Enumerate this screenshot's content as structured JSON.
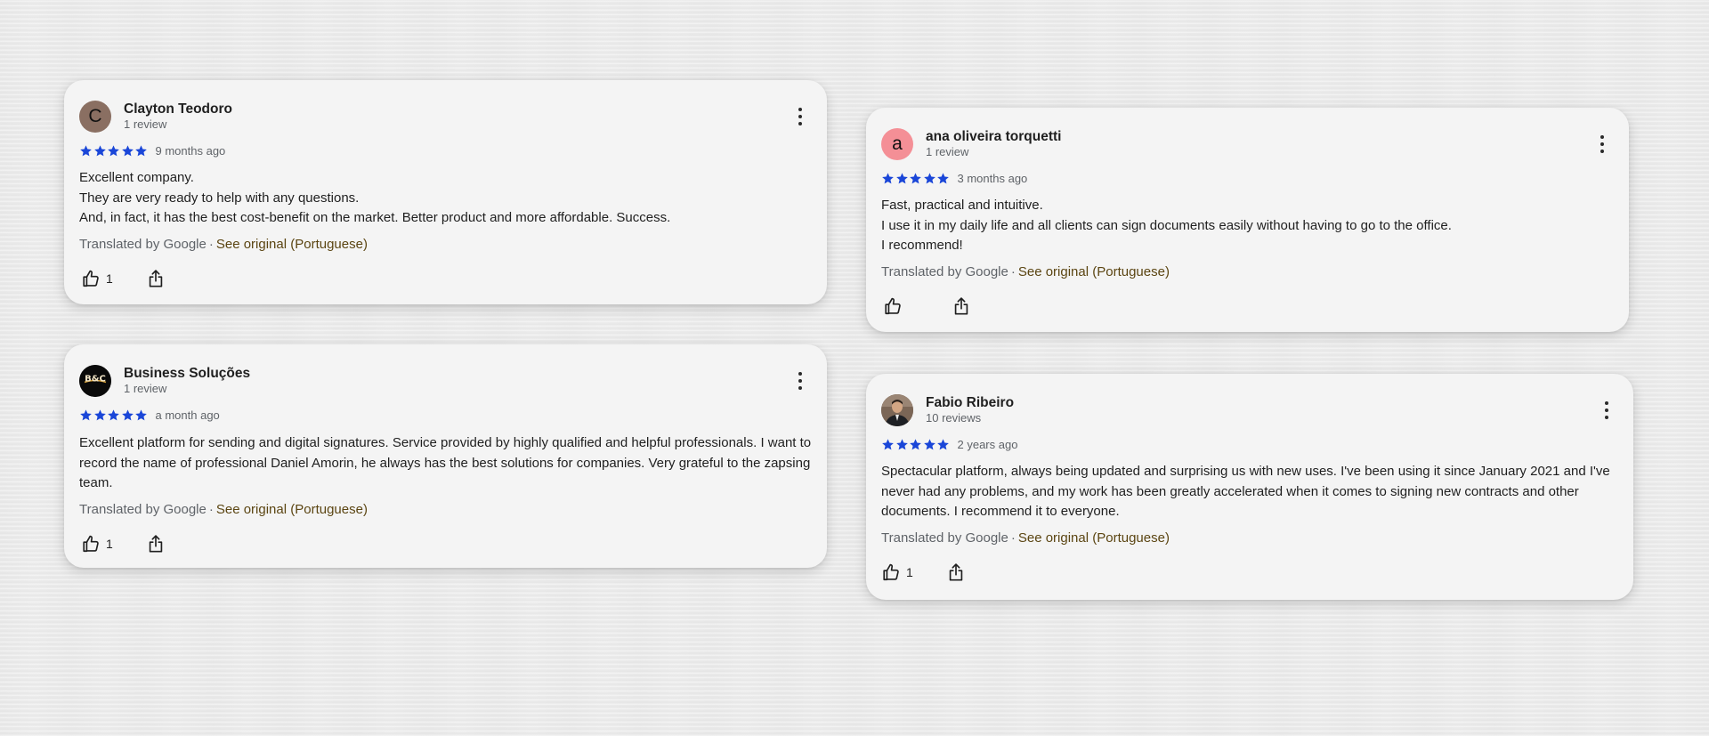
{
  "colors": {
    "star": "#1a46d8",
    "translated_link": "#5b4512",
    "card_background": "#f4f4f4"
  },
  "reviews": [
    {
      "author": "Clayton Teodoro",
      "review_count": "1 review",
      "avatar": {
        "letter": "C",
        "color": "#8a6f62"
      },
      "rating": 5,
      "time": "9 months ago",
      "text_lines": [
        "Excellent company.",
        "They are very ready to help with any questions.",
        "And, in fact, it has the best cost-benefit on the market. Better product and more affordable. Success."
      ],
      "translated_by": "Translated by Google",
      "see_original": "See original (Portuguese)",
      "likes": "1"
    },
    {
      "author": "ana oliveira torquetti",
      "review_count": "1 review",
      "avatar": {
        "letter": "a",
        "color": "#f48f96"
      },
      "rating": 5,
      "time": "3 months ago",
      "text_lines": [
        "Fast, practical and intuitive.",
        "I use it in my daily life and all clients can sign documents easily without having to go to the office.",
        "I recommend!"
      ],
      "translated_by": "Translated by Google",
      "see_original": "See original (Portuguese)",
      "likes": ""
    },
    {
      "author": "Business Soluções",
      "review_count": "1 review",
      "avatar": {
        "letter": "B&C",
        "color": "#0a0a0a"
      },
      "rating": 5,
      "time": "a month ago",
      "text_lines": [
        "Excellent platform for sending and digital signatures. Service provided by highly qualified and helpful professionals. I want to record the name of professional Daniel Amorin, he always has the best solutions for companies. Very grateful to the zapsing team."
      ],
      "translated_by": "Translated by Google",
      "see_original": "See original (Portuguese)",
      "likes": "1"
    },
    {
      "author": "Fabio Ribeiro",
      "review_count": "10 reviews",
      "avatar": {
        "letter": "",
        "color": "#6b5a4e"
      },
      "rating": 5,
      "time": "2 years ago",
      "text_lines": [
        "Spectacular platform, always being updated and surprising us with new uses. I've been using it since January 2021 and I've never had any problems, and my work has been greatly accelerated when it comes to signing new contracts and other documents. I recommend it to everyone."
      ],
      "translated_by": "Translated by Google",
      "see_original": "See original (Portuguese)",
      "likes": "1"
    }
  ]
}
